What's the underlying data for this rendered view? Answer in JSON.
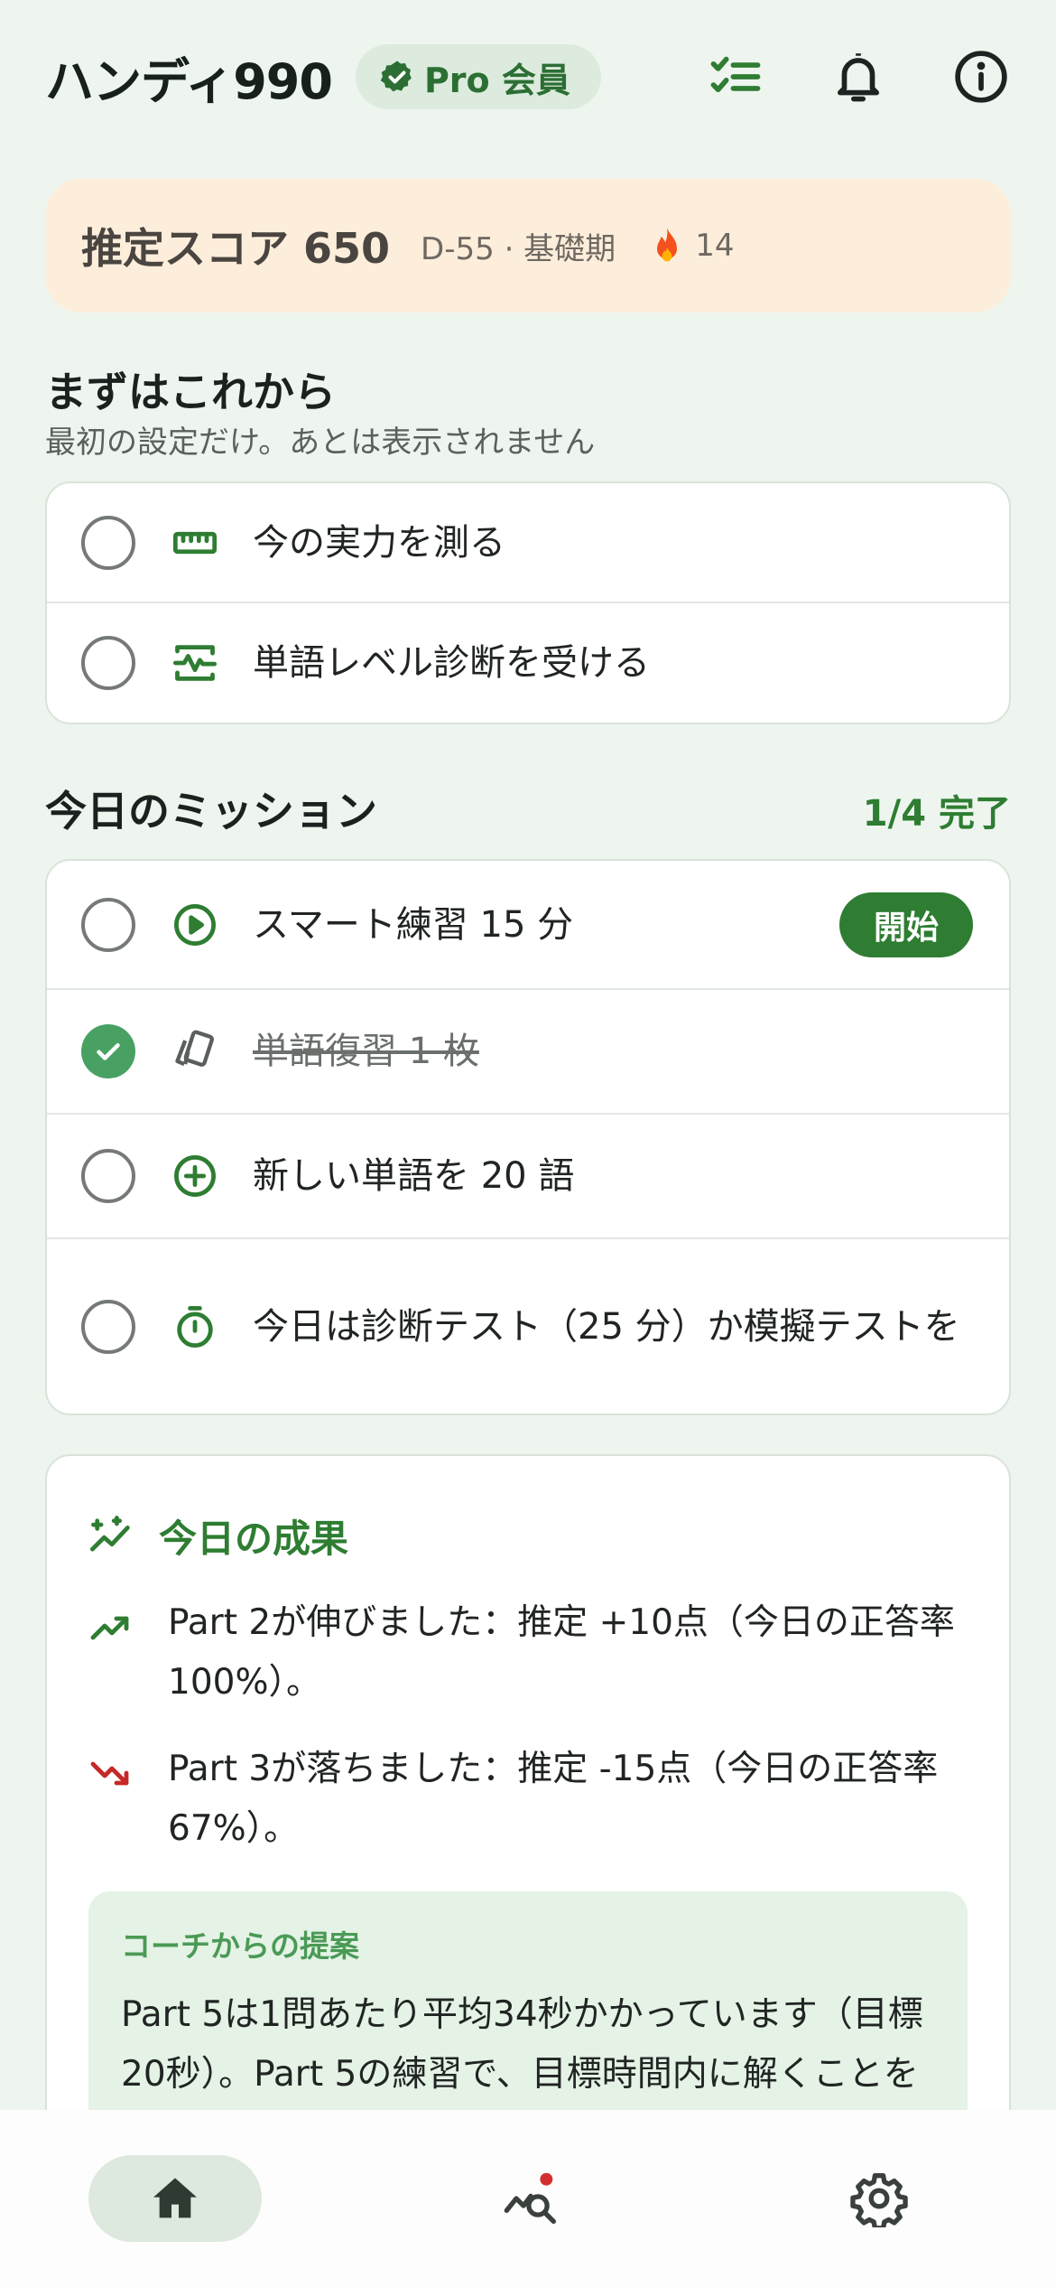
{
  "header": {
    "app_title": "ハンディ990",
    "pro_badge": "Pro 会員",
    "icons": [
      "checklist-icon",
      "bell-icon",
      "info-icon"
    ]
  },
  "score_card": {
    "score_label": "推定スコア 650",
    "meta": "D-55 · 基礎期",
    "streak_count": "14"
  },
  "onboarding": {
    "title": "まずはこれから",
    "subtitle": "最初の設定だけ。あとは表示されません",
    "items": [
      {
        "label": "今の実力を測る",
        "icon": "ruler-icon",
        "checked": false
      },
      {
        "label": "単語レベル診断を受ける",
        "icon": "diagnosis-chart-icon",
        "checked": false
      }
    ]
  },
  "missions": {
    "title": "今日のミッション",
    "count": "1/4 完了",
    "start_label": "開始",
    "items": [
      {
        "label": "スマート練習 15 分",
        "icon": "play-circle-icon",
        "checked": false
      },
      {
        "label": "単語復習 1 枚",
        "icon": "cards-icon",
        "checked": true
      },
      {
        "label": "新しい単語を 20 語",
        "icon": "add-circle-icon",
        "checked": false
      },
      {
        "label": "今日は診断テスト（25 分）か模擬テストを",
        "icon": "timer-icon",
        "checked": false
      }
    ]
  },
  "results": {
    "title": "今日の成果",
    "items": [
      {
        "text": "Part 2が伸びました：推定 +10点（今日の正答率100%）。",
        "trend": "up"
      },
      {
        "text": "Part 3が落ちました：推定 -15点（今日の正答率67%）。",
        "trend": "down"
      }
    ],
    "coach_label": "コーチからの提案",
    "coach_text": "Part 5は1問あたり平均34秒かかっています（目標20秒）。Part 5の練習で、目標時間内に解くことを意識してみましょう。"
  },
  "bottom_nav": {
    "active": "home",
    "items": [
      "home-icon",
      "analytics-search-icon",
      "settings-gear-icon"
    ]
  },
  "colors": {
    "background": "#eef5ef",
    "accent": "#2e7d32",
    "check": "#48a163",
    "score_card": "#fdeedb",
    "down": "#c62828"
  }
}
